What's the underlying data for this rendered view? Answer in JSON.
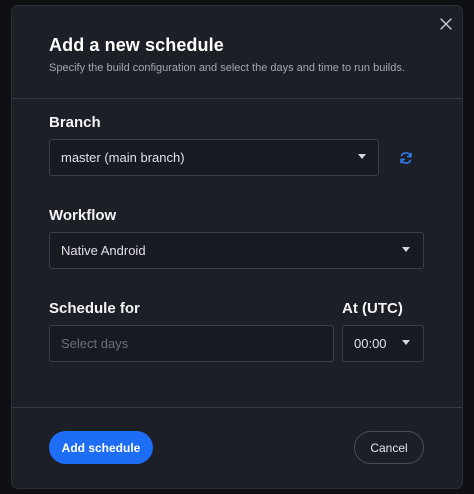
{
  "dialog": {
    "title": "Add a new schedule",
    "subtitle": "Specify the build configuration and select the days and time to run builds."
  },
  "branch": {
    "label": "Branch",
    "value": "master (main branch)"
  },
  "workflow": {
    "label": "Workflow",
    "value": "Native Android"
  },
  "schedule": {
    "label": "Schedule for",
    "placeholder": "Select days"
  },
  "time": {
    "label": "At (UTC)",
    "value": "00:00"
  },
  "footer": {
    "primary_label": "Add schedule",
    "secondary_label": "Cancel"
  },
  "icons": {
    "close": "close-icon",
    "refresh": "refresh-icon",
    "caret": "chevron-down-icon"
  },
  "colors": {
    "accent": "#1d6ef5",
    "surface": "#1d1f27",
    "field": "#181a21"
  }
}
